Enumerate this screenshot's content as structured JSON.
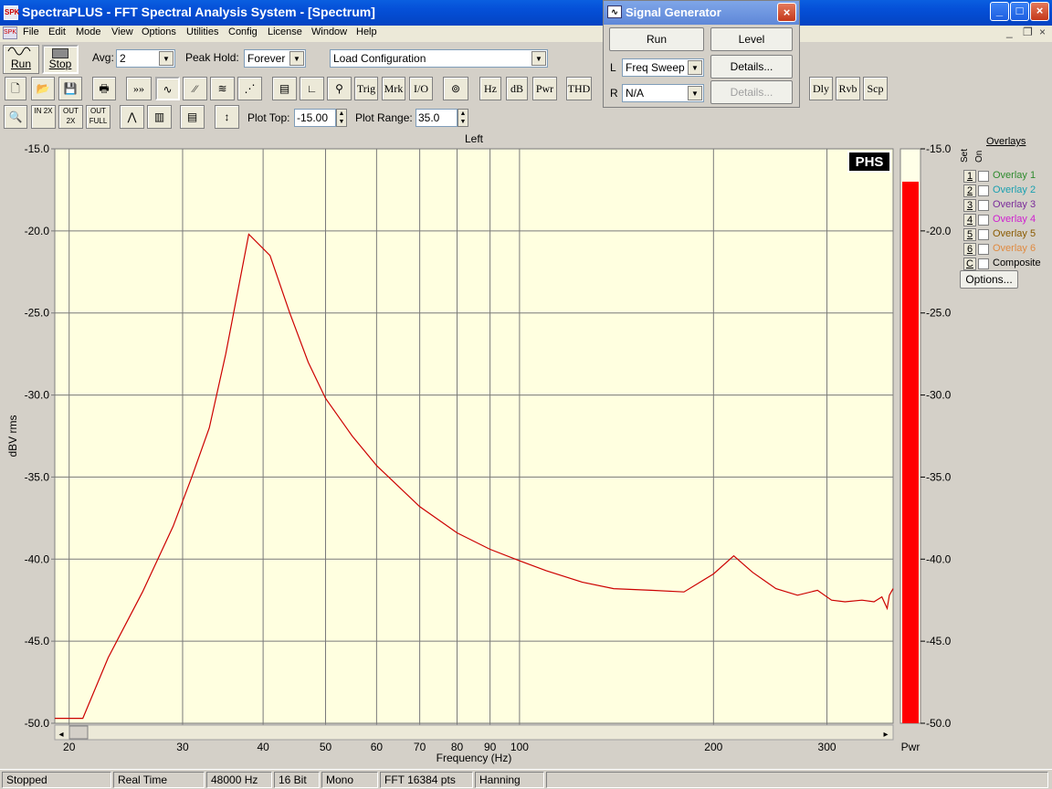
{
  "app": {
    "title": "SpectraPLUS - FFT Spectral Analysis System - [Spectrum]",
    "icon_text": "SPK"
  },
  "menu": [
    "File",
    "Edit",
    "Mode",
    "View",
    "Options",
    "Utilities",
    "Config",
    "License",
    "Window",
    "Help"
  ],
  "toolbar1": {
    "run_label": "Run",
    "stop_label": "Stop",
    "avg_label": "Avg:",
    "avg_value": "2",
    "peakhold_label": "Peak Hold:",
    "peakhold_value": "Forever",
    "config_value": "Load Configuration"
  },
  "toolbar2": {
    "trig": "Trig",
    "mrk": "Mrk",
    "io": "I/O",
    "hz": "Hz",
    "db": "dB",
    "pwr": "Pwr",
    "thd": "THD",
    "dly": "Dly",
    "rvb": "Rvb",
    "scp": "Scp"
  },
  "toolbar3": {
    "plot_top_label": "Plot Top:",
    "plot_top_value": "-15.00",
    "plot_range_label": "Plot Range:",
    "plot_range_value": "35.0",
    "zoom_in": "IN 2X",
    "zoom_out": "OUT 2X",
    "zoom_full": "OUT FULL"
  },
  "siggen": {
    "title": "Signal Generator",
    "run": "Run",
    "level": "Level",
    "l_label": "L",
    "l_value": "Freq Sweep",
    "r_label": "R",
    "r_value": "N/A",
    "details": "Details...",
    "details_disabled": "Details..."
  },
  "overlays": {
    "title": "Overlays",
    "set_header": "Set",
    "on_header": "On",
    "items": [
      {
        "num": "1",
        "label": "Overlay 1",
        "color": "#2e8b2e"
      },
      {
        "num": "2",
        "label": "Overlay 2",
        "color": "#1aa0b0"
      },
      {
        "num": "3",
        "label": "Overlay 3",
        "color": "#7a2a9a"
      },
      {
        "num": "4",
        "label": "Overlay 4",
        "color": "#d020d0"
      },
      {
        "num": "5",
        "label": "Overlay 5",
        "color": "#8a5a00"
      },
      {
        "num": "6",
        "label": "Overlay 6",
        "color": "#e08a40"
      },
      {
        "num": "C",
        "label": "Composite",
        "color": "#000000"
      }
    ],
    "options": "Options..."
  },
  "chart_data": {
    "type": "line",
    "title": "Left",
    "xlabel": "Frequency (Hz)",
    "ylabel": "dBV rms",
    "xscale": "log",
    "xlim": [
      19,
      380
    ],
    "ylim": [
      -50,
      -15
    ],
    "xticks": [
      20,
      30,
      40,
      50,
      60,
      70,
      80,
      90,
      100,
      200,
      300
    ],
    "yticks": [
      -15.0,
      -20.0,
      -25.0,
      -30.0,
      -35.0,
      -40.0,
      -45.0,
      -50.0
    ],
    "ytick_labels": [
      "-15.0",
      "-20.0",
      "-25.0",
      "-30.0",
      "-35.0",
      "-40.0",
      "-45.0",
      "-50.0"
    ],
    "grid": true,
    "line_color": "#cc0000",
    "plot_bg": "#ffffe0",
    "badge": "PHS",
    "series": [
      {
        "x": [
          19,
          21,
          23,
          26,
          29,
          31,
          33,
          35,
          38,
          41,
          44,
          47,
          50,
          55,
          60,
          70,
          80,
          90,
          100,
          110,
          125,
          140,
          160,
          180,
          200,
          215,
          230,
          250,
          270,
          290,
          305,
          320,
          340,
          355,
          365,
          370,
          372,
          375,
          380
        ],
        "y": [
          -49.7,
          -49.7,
          -46.0,
          -42.0,
          -38.0,
          -35.0,
          -32.0,
          -27.5,
          -20.2,
          -21.5,
          -25.0,
          -28.0,
          -30.2,
          -32.5,
          -34.3,
          -36.8,
          -38.4,
          -39.4,
          -40.1,
          -40.7,
          -41.4,
          -41.8,
          -41.9,
          -42.0,
          -40.9,
          -39.8,
          -40.8,
          -41.8,
          -42.2,
          -41.9,
          -42.5,
          -42.6,
          -42.5,
          -42.6,
          -42.3,
          -42.8,
          -43.0,
          -42.2,
          -41.8
        ]
      }
    ],
    "meter": {
      "label": "Pwr",
      "value": -17.0,
      "color": "#ff0000",
      "ticks": [
        "-15.0",
        "-20.0",
        "-25.0",
        "-30.0",
        "-35.0",
        "-40.0",
        "-45.0",
        "-50.0"
      ]
    }
  },
  "status": [
    "Stopped",
    "Real Time",
    "48000 Hz",
    "16 Bit",
    "Mono",
    "FFT 16384 pts",
    "Hanning"
  ]
}
